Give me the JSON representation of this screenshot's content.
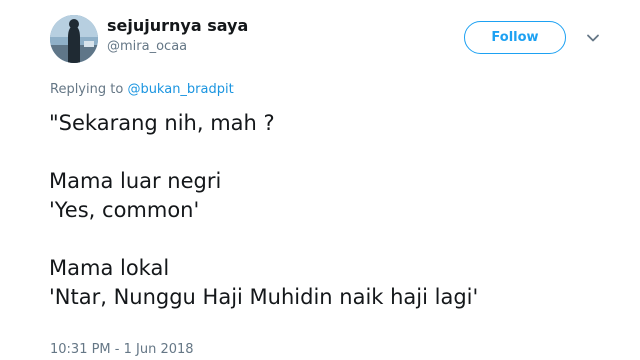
{
  "user": {
    "display_name": "sejujurnya saya",
    "handle": "@mira_ocaa",
    "avatar_icon": "profile-photo"
  },
  "follow": {
    "label": "Follow",
    "accent": "#1da1f2"
  },
  "menu": {
    "icon": "chevron-down-icon"
  },
  "reply": {
    "prefix": "Replying to",
    "mention": "@bukan_bradpit"
  },
  "tweet": {
    "lines": [
      "\"Sekarang nih, mah ?",
      "",
      "Mama luar negri",
      "'Yes, common'",
      "",
      "Mama lokal",
      "'Ntar, Nunggu Haji Muhidin naik haji lagi'"
    ]
  },
  "meta": {
    "timestamp": "10:31 PM - 1 Jun 2018"
  }
}
